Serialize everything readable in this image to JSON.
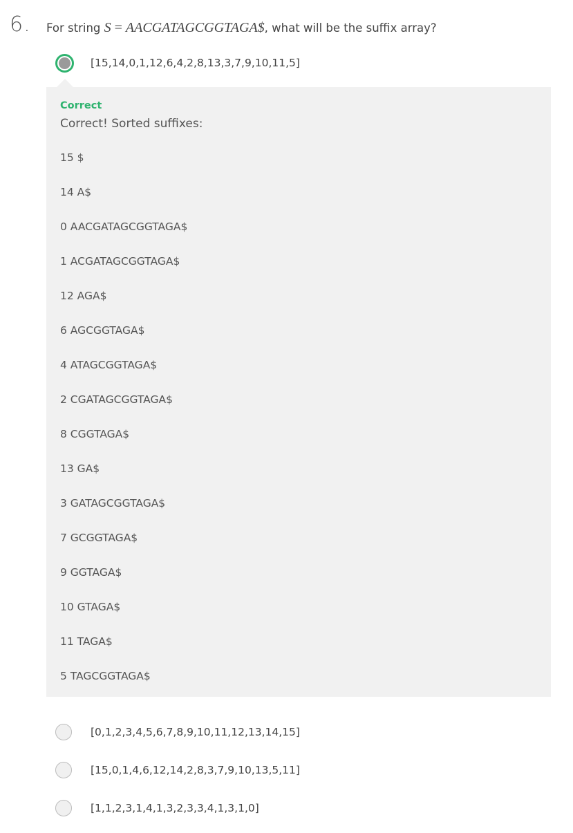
{
  "question": {
    "number": "6.",
    "prefix": "For string ",
    "math_var": "S",
    "math_eq": " = ",
    "math_string": "AACGATAGCGGTAGA$",
    "suffix": ", what will be the suffix array?"
  },
  "options": [
    {
      "label": "[15,14,0,1,12,6,4,2,8,13,3,7,9,10,11,5]",
      "selected": true
    },
    {
      "label": "[0,1,2,3,4,5,6,7,8,9,10,11,12,13,14,15]",
      "selected": false
    },
    {
      "label": "[15,0,1,4,6,12,14,2,8,3,7,9,10,13,5,11]",
      "selected": false
    },
    {
      "label": "[1,1,2,3,1,4,1,3,2,3,3,4,1,3,1,0]",
      "selected": false
    }
  ],
  "feedback": {
    "status": "Correct",
    "message": "Correct! Sorted suffixes:",
    "suffixes": [
      "15 $",
      "14 A$",
      "0 AACGATAGCGGTAGA$",
      "1 ACGATAGCGGTAGA$",
      "12 AGA$",
      "6 AGCGGTAGA$",
      "4 ATAGCGGTAGA$",
      "2 CGATAGCGGTAGA$",
      "8 CGGTAGA$",
      "13 GA$",
      "3 GATAGCGGTAGA$",
      "7 GCGGTAGA$",
      "9 GGTAGA$",
      "10 GTAGA$",
      "11 TAGA$",
      "5 TAGCGGTAGA$"
    ]
  },
  "colors": {
    "correct": "#2fb36f",
    "feedback_bg": "#f1f1f1"
  }
}
